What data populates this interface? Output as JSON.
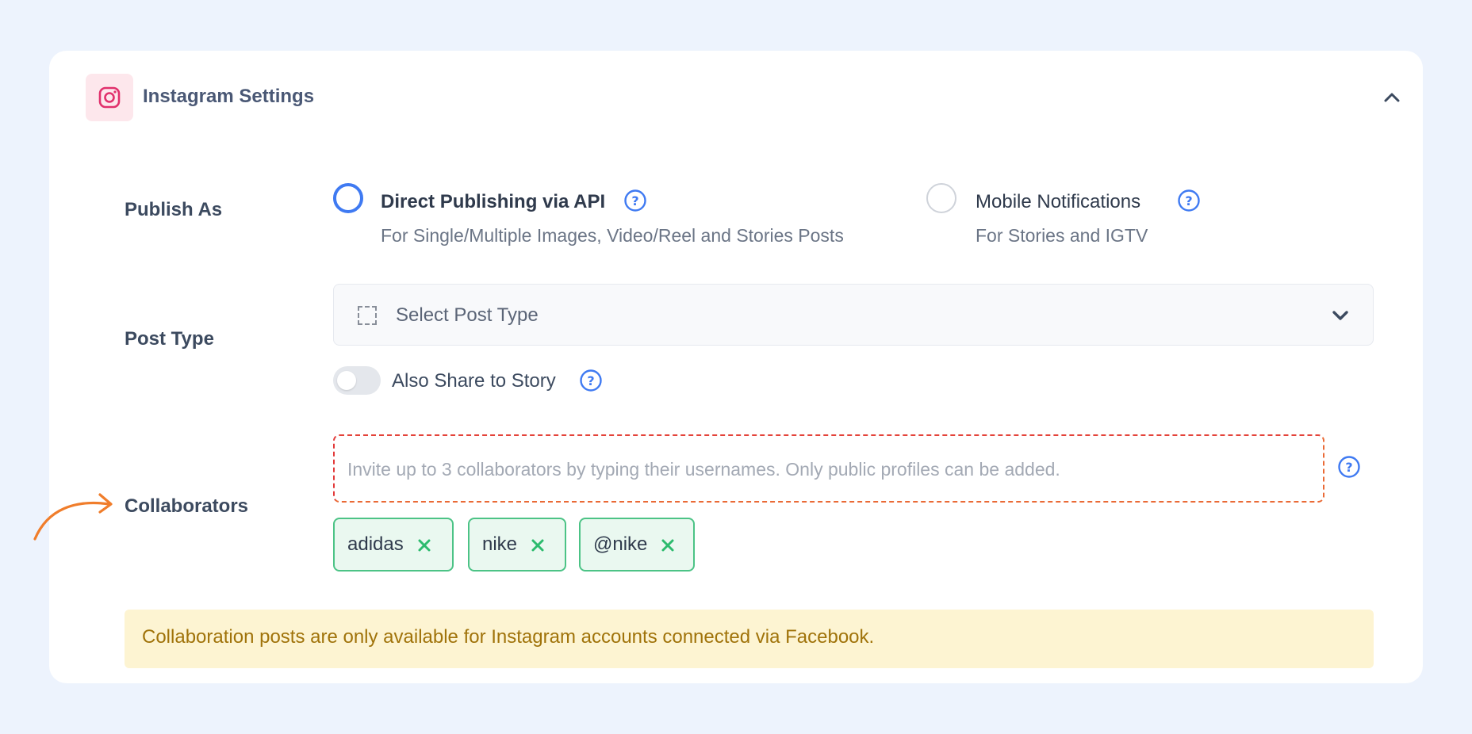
{
  "header": {
    "title": "Instagram Settings",
    "icon": "instagram-icon",
    "collapse_icon": "chevron-up-icon"
  },
  "publish_as": {
    "label": "Publish As",
    "options": [
      {
        "title": "Direct Publishing via API",
        "description": "For Single/Multiple Images, Video/Reel and Stories Posts",
        "selected": true
      },
      {
        "title": "Mobile Notifications",
        "description": "For Stories and IGTV",
        "selected": false
      }
    ]
  },
  "post_type": {
    "label": "Post Type",
    "placeholder": "Select Post Type",
    "share_to_story_label": "Also Share to Story",
    "share_to_story_enabled": false
  },
  "collaborators": {
    "label": "Collaborators",
    "placeholder": "Invite up to 3 collaborators by typing their usernames. Only public profiles can be added.",
    "tags": [
      "adidas",
      "nike",
      "@nike"
    ]
  },
  "notice": {
    "text": "Collaboration posts are only available for Instagram accounts connected via Facebook."
  },
  "colors": {
    "accent": "#3f7af2",
    "instagram": "#e1306c",
    "chip_border": "#4cc386",
    "chip_bg": "#eaf8f0",
    "error_border": "#e4433a",
    "notice_bg": "#fdf4d2",
    "notice_text": "#a0730a",
    "annotation_arrow": "#f07d2b"
  }
}
